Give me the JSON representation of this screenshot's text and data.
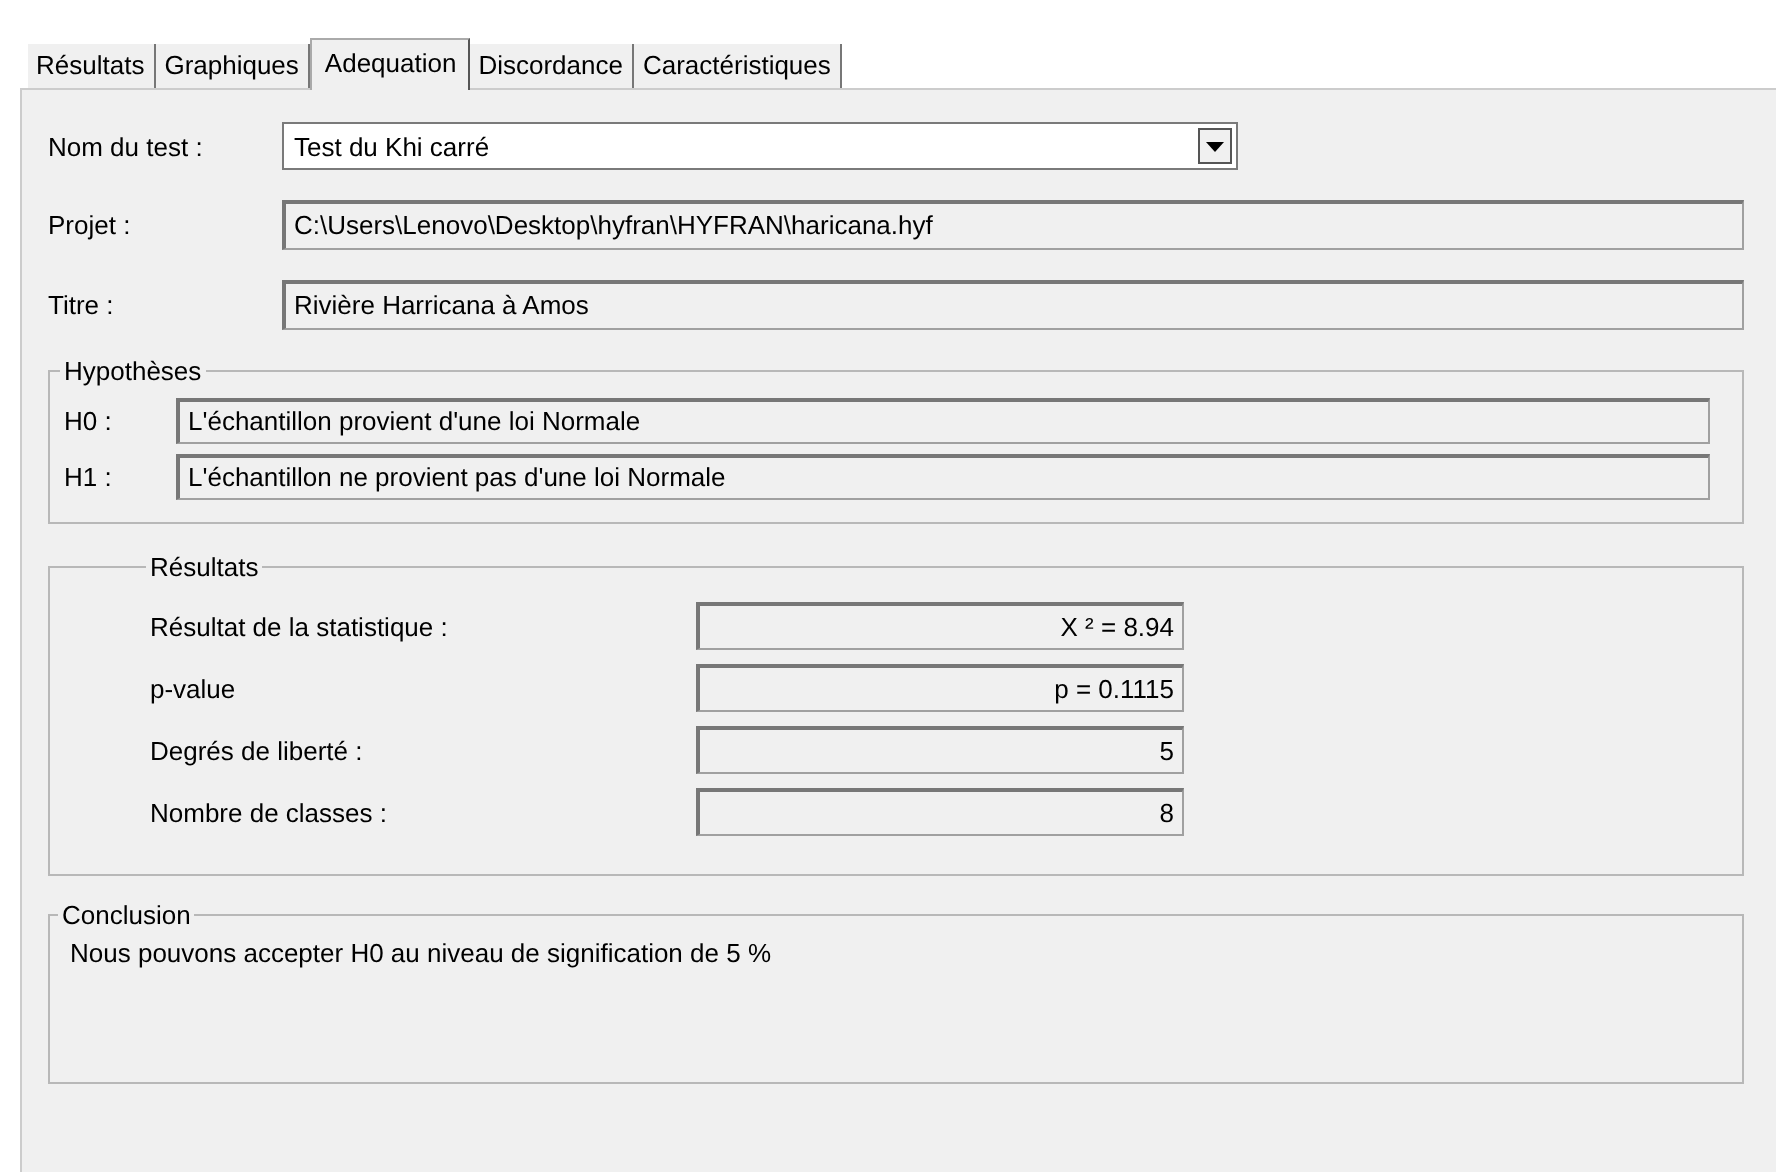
{
  "tabs": [
    {
      "label": "Résultats",
      "selected": false
    },
    {
      "label": "Graphiques",
      "selected": false
    },
    {
      "label": "Adequation",
      "selected": true
    },
    {
      "label": "Discordance",
      "selected": false
    },
    {
      "label": "Caractéristiques",
      "selected": false
    }
  ],
  "test_name": {
    "label": "Nom du test :",
    "value": "Test du Khi carré"
  },
  "project": {
    "label": "Projet :",
    "value": "C:\\Users\\Lenovo\\Desktop\\hyfran\\HYFRAN\\haricana.hyf"
  },
  "title": {
    "label": "Titre :",
    "value": "Rivière Harricana à Amos"
  },
  "hypotheses": {
    "legend": "Hypothèses",
    "items": [
      {
        "label": "H0 :",
        "value": "L'échantillon provient d'une loi Normale"
      },
      {
        "label": "H1 :",
        "value": "L'échantillon ne provient pas d'une loi Normale"
      }
    ]
  },
  "results": {
    "legend": "Résultats",
    "items": [
      {
        "label": "Résultat de la statistique :",
        "value": "X ² = 8.94"
      },
      {
        "label": "p-value",
        "value": "p = 0.1115"
      },
      {
        "label": "Degrés de liberté :",
        "value": "5"
      },
      {
        "label": "Nombre de classes :",
        "value": "8"
      }
    ]
  },
  "conclusion": {
    "legend": "Conclusion",
    "text": "Nous pouvons accepter H0 au niveau de signification de 5 %"
  }
}
